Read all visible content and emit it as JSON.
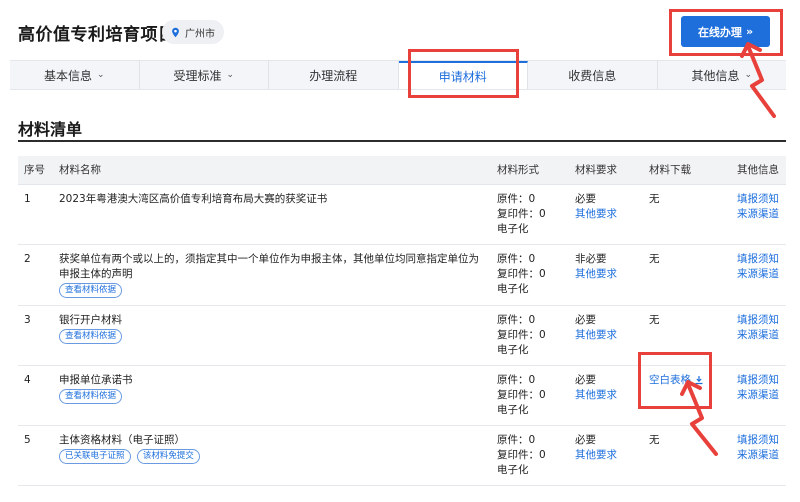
{
  "header": {
    "title": "高价值专利培育项目",
    "city": "广州市",
    "online_button": "在线办理",
    "online_button_arrows": "»"
  },
  "tabs": [
    {
      "label": "基本信息",
      "dropdown": true
    },
    {
      "label": "受理标准",
      "dropdown": true
    },
    {
      "label": "办理流程",
      "dropdown": false
    },
    {
      "label": "申请材料",
      "dropdown": false,
      "active": true
    },
    {
      "label": "收费信息",
      "dropdown": false
    },
    {
      "label": "其他信息",
      "dropdown": true
    }
  ],
  "section": {
    "title": "材料清单"
  },
  "table": {
    "headers": [
      "序号",
      "材料名称",
      "材料形式",
      "材料要求",
      "材料下载",
      "其他信息"
    ],
    "rows": [
      {
        "no": "1",
        "name": "2023年粤港澳大湾区高价值专利培育布局大赛的获奖证书",
        "tags": [],
        "form_original": "原件：0",
        "form_copy": "复印件：0",
        "form_digital": "电子化",
        "requirement": "必要",
        "other_req": "其他要求",
        "download": "无",
        "info1": "填报须知",
        "info2": "来源渠道"
      },
      {
        "no": "2",
        "name": "获奖单位有两个或以上的，须指定其中一个单位作为申报主体，其他单位均同意指定单位为申报主体的声明",
        "tags": [
          "查看材料依据"
        ],
        "form_original": "原件：0",
        "form_copy": "复印件：0",
        "form_digital": "电子化",
        "requirement": "非必要",
        "other_req": "其他要求",
        "download": "无",
        "info1": "填报须知",
        "info2": "来源渠道"
      },
      {
        "no": "3",
        "name": "银行开户材料",
        "tags": [
          "查看材料依据"
        ],
        "form_original": "原件：0",
        "form_copy": "复印件：0",
        "form_digital": "电子化",
        "requirement": "必要",
        "other_req": "其他要求",
        "download": "无",
        "info1": "填报须知",
        "info2": "来源渠道"
      },
      {
        "no": "4",
        "name": "申报单位承诺书",
        "tags": [
          "查看材料依据"
        ],
        "form_original": "原件：0",
        "form_copy": "复印件：0",
        "form_digital": "电子化",
        "requirement": "必要",
        "other_req": "其他要求",
        "download": "空白表格",
        "info1": "填报须知",
        "info2": "来源渠道"
      },
      {
        "no": "5",
        "name": "主体资格材料（电子证照）",
        "tags": [
          "已关联电子证照",
          "该材料免提交"
        ],
        "form_original": "原件：0",
        "form_copy": "复印件：0",
        "form_digital": "电子化",
        "requirement": "必要",
        "other_req": "其他要求",
        "download": "无",
        "info1": "填报须知",
        "info2": "来源渠道"
      }
    ]
  },
  "colors": {
    "accent": "#1e6fdc",
    "annotation": "#e8403a"
  }
}
